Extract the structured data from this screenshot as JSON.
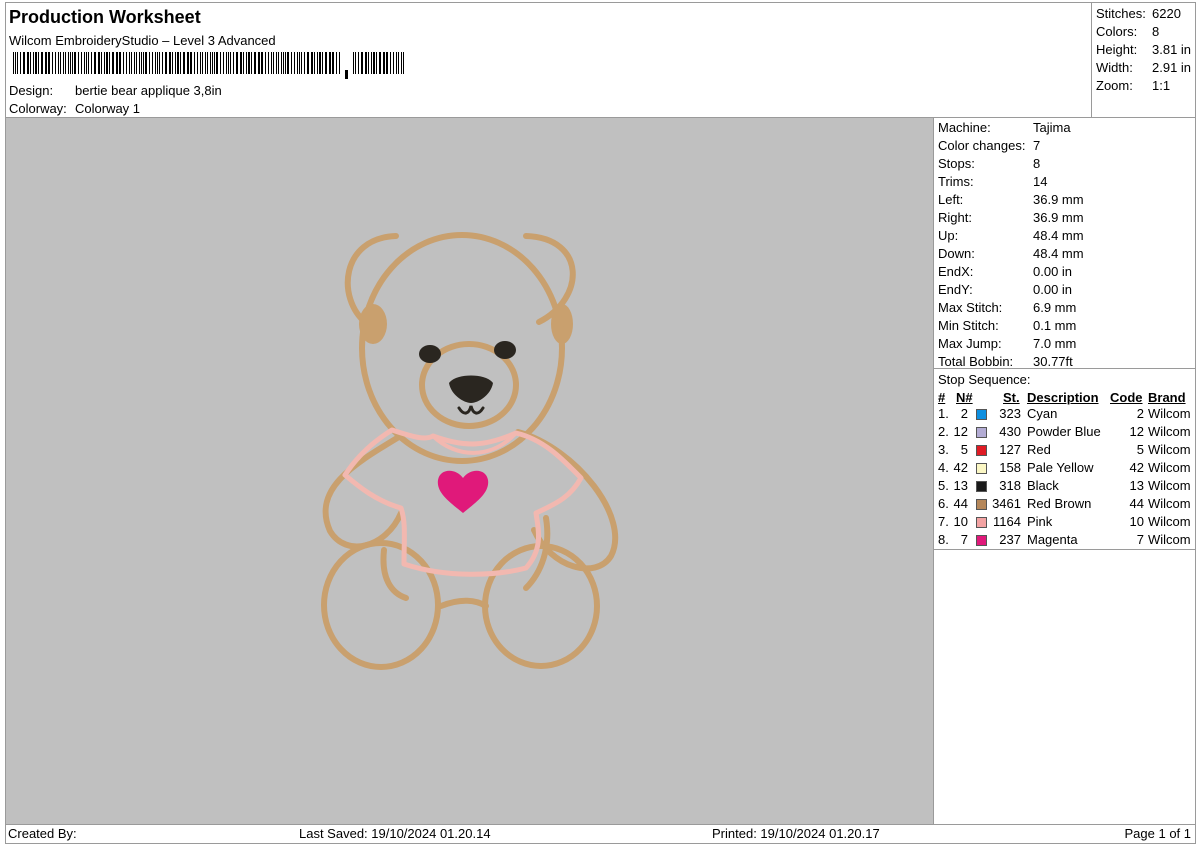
{
  "header": {
    "title": "Production Worksheet",
    "subtitle": "Wilcom EmbroideryStudio – Level 3 Advanced",
    "design_label": "Design:",
    "design_value": "bertie bear applique 3,8in",
    "colorway_label": "Colorway:",
    "colorway_value": "Colorway 1"
  },
  "summary": {
    "stitches_label": "Stitches:",
    "stitches_value": "6220",
    "colors_label": "Colors:",
    "colors_value": "8",
    "height_label": "Height:",
    "height_value": "3.81 in",
    "width_label": "Width:",
    "width_value": "2.91 in",
    "zoom_label": "Zoom:",
    "zoom_value": "1:1"
  },
  "details": [
    {
      "label": "Machine:",
      "value": "Tajima"
    },
    {
      "label": "Color changes:",
      "value": "7"
    },
    {
      "label": "Stops:",
      "value": "8"
    },
    {
      "label": "Trims:",
      "value": "14"
    },
    {
      "label": "Left:",
      "value": "36.9 mm"
    },
    {
      "label": "Right:",
      "value": "36.9 mm"
    },
    {
      "label": "Up:",
      "value": "48.4 mm"
    },
    {
      "label": "Down:",
      "value": "48.4 mm"
    },
    {
      "label": "EndX:",
      "value": "0.00 in"
    },
    {
      "label": "EndY:",
      "value": "0.00 in"
    },
    {
      "label": "Max Stitch:",
      "value": "6.9 mm"
    },
    {
      "label": "Min Stitch:",
      "value": "0.1 mm"
    },
    {
      "label": "Max Jump:",
      "value": "7.0 mm"
    },
    {
      "label": "Total Bobbin:",
      "value": "30.77ft"
    }
  ],
  "stop_sequence": {
    "title": "Stop Sequence:",
    "columns": {
      "num": "#",
      "n": "N#",
      "st": "St.",
      "description": "Description",
      "code": "Code",
      "brand": "Brand"
    },
    "rows": [
      {
        "num": "1.",
        "n": "2",
        "color": "#0e8fe0",
        "st": "323",
        "description": "Cyan",
        "code": "2",
        "brand": "Wilcom"
      },
      {
        "num": "2.",
        "n": "12",
        "color": "#b3acd4",
        "st": "430",
        "description": "Powder Blue",
        "code": "12",
        "brand": "Wilcom"
      },
      {
        "num": "3.",
        "n": "5",
        "color": "#e01b24",
        "st": "127",
        "description": "Red",
        "code": "5",
        "brand": "Wilcom"
      },
      {
        "num": "4.",
        "n": "42",
        "color": "#fbf7c4",
        "st": "158",
        "description": "Pale Yellow",
        "code": "42",
        "brand": "Wilcom"
      },
      {
        "num": "5.",
        "n": "13",
        "color": "#1a1a1a",
        "st": "318",
        "description": "Black",
        "code": "13",
        "brand": "Wilcom"
      },
      {
        "num": "6.",
        "n": "44",
        "color": "#b5875a",
        "st": "3461",
        "description": "Red Brown",
        "code": "44",
        "brand": "Wilcom"
      },
      {
        "num": "7.",
        "n": "10",
        "color": "#f3a3a3",
        "st": "1164",
        "description": "Pink",
        "code": "10",
        "brand": "Wilcom"
      },
      {
        "num": "8.",
        "n": "7",
        "color": "#e0197a",
        "st": "237",
        "description": "Magenta",
        "code": "7",
        "brand": "Wilcom"
      }
    ]
  },
  "footer": {
    "created_by": "Created By:",
    "last_saved": "Last Saved: 19/10/2024 01.20.14",
    "printed": "Printed: 19/10/2024 01.20.17",
    "page": "Page 1 of 1"
  },
  "colors": {
    "canvas_bg": "#c0c0c0",
    "bear_outline": "#c9a06e",
    "shirt_outline": "#f2b8b0",
    "heart": "#e0197a",
    "eyes_nose": "#2a2620"
  }
}
